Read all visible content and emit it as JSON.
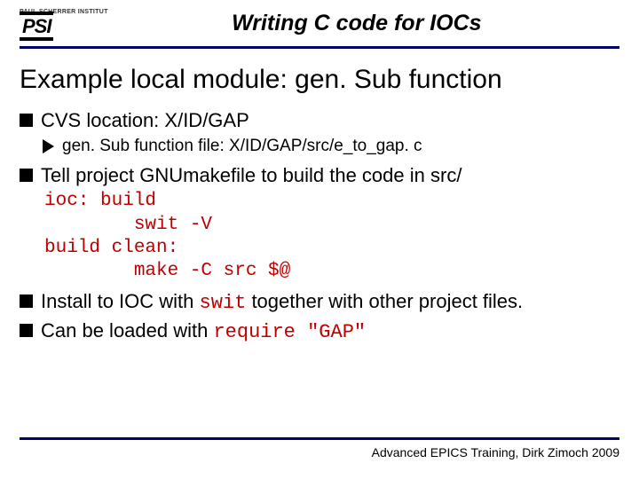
{
  "logo": {
    "institute": "PAUL SCHERRER INSTITUT",
    "abbr": "PSI"
  },
  "slide_title": "Writing C code for IOCs",
  "heading": "Example local module: gen. Sub function",
  "bullets": {
    "cvs": "CVS location: X/ID/GAP",
    "gensub": "gen. Sub function file: X/ID/GAP/src/e_to_gap. c",
    "tell": "Tell project GNUmakefile to build the code in src/",
    "code": "ioc: build\n        swit -V\nbuild clean:\n        make -C src $@",
    "install_pre": "Install to IOC with ",
    "install_code": "swit",
    "install_post": " together with other project files.",
    "load_pre": "Can be loaded with ",
    "load_code": "require \"GAP\""
  },
  "footer": "Advanced EPICS Training, Dirk Zimoch 2009"
}
